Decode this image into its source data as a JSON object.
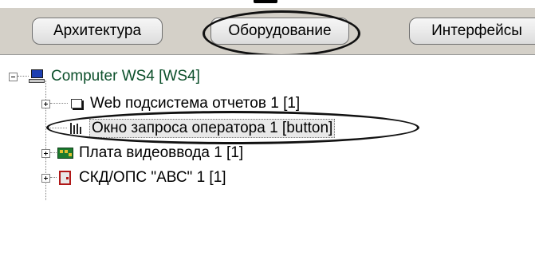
{
  "tabs": [
    {
      "label": "Архитектура",
      "active": false
    },
    {
      "label": "Оборудование",
      "active": true
    },
    {
      "label": "Интерфейсы",
      "active": false
    }
  ],
  "tree": {
    "root": {
      "label": "Computer WS4 [WS4]",
      "icon": "computer-icon",
      "expanded": true
    },
    "children": [
      {
        "label": "Web подсистема отчетов 1 [1]",
        "icon": "web-report-icon",
        "has_children": true
      },
      {
        "label": "Окно запроса оператора 1 [button]",
        "icon": "operator-request-icon",
        "has_children": false,
        "selected": true
      },
      {
        "label": "Плата видеоввода 1 [1]",
        "icon": "video-capture-board-icon",
        "has_children": true
      },
      {
        "label": "СКД/ОПС \"АВС\" 1 [1]",
        "icon": "access-control-icon",
        "has_children": true
      }
    ]
  },
  "colors": {
    "root_label": "#0b4f2a",
    "tab_bar": "#d4d0c8",
    "highlight_outline": "#111111"
  }
}
